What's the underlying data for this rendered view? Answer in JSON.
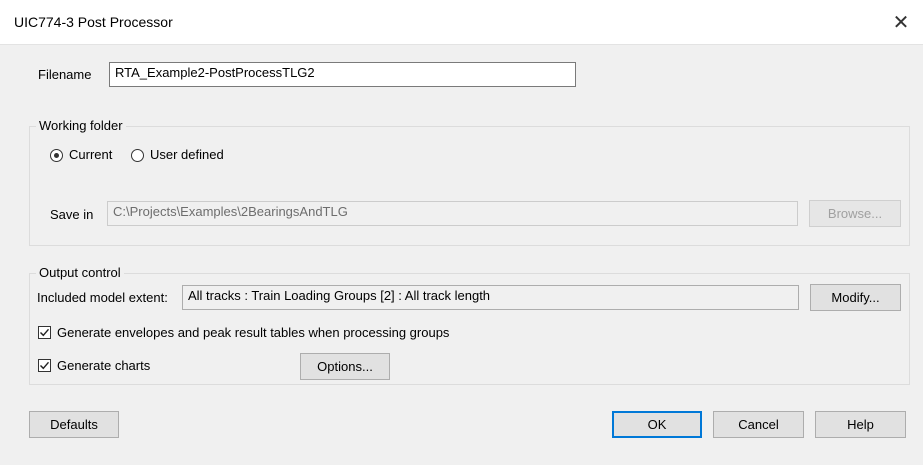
{
  "window": {
    "title": "UIC774-3 Post Processor",
    "close_glyph": "✕"
  },
  "filename": {
    "label": "Filename",
    "value": "RTA_Example2-PostProcessTLG2"
  },
  "working_folder": {
    "title": "Working folder",
    "options": [
      {
        "label": "Current",
        "selected": true
      },
      {
        "label": "User defined",
        "selected": false
      }
    ],
    "save_in_label": "Save in",
    "save_in_value": "C:\\Projects\\Examples\\2BearingsAndTLG",
    "browse_label": "Browse..."
  },
  "output_control": {
    "title": "Output control",
    "extent_label": "Included model extent:",
    "extent_value": "All tracks : Train Loading Groups [2] : All track length",
    "modify_label": "Modify...",
    "envelopes_label": "Generate envelopes and peak result tables when processing groups",
    "envelopes_checked": true,
    "charts_label": "Generate charts",
    "charts_checked": true,
    "options_label": "Options..."
  },
  "buttons": {
    "defaults": "Defaults",
    "ok": "OK",
    "cancel": "Cancel",
    "help": "Help"
  },
  "colors": {
    "accent": "#0078d7",
    "window_bg": "#f0f0f0",
    "titlebar_bg": "#ffffff"
  }
}
